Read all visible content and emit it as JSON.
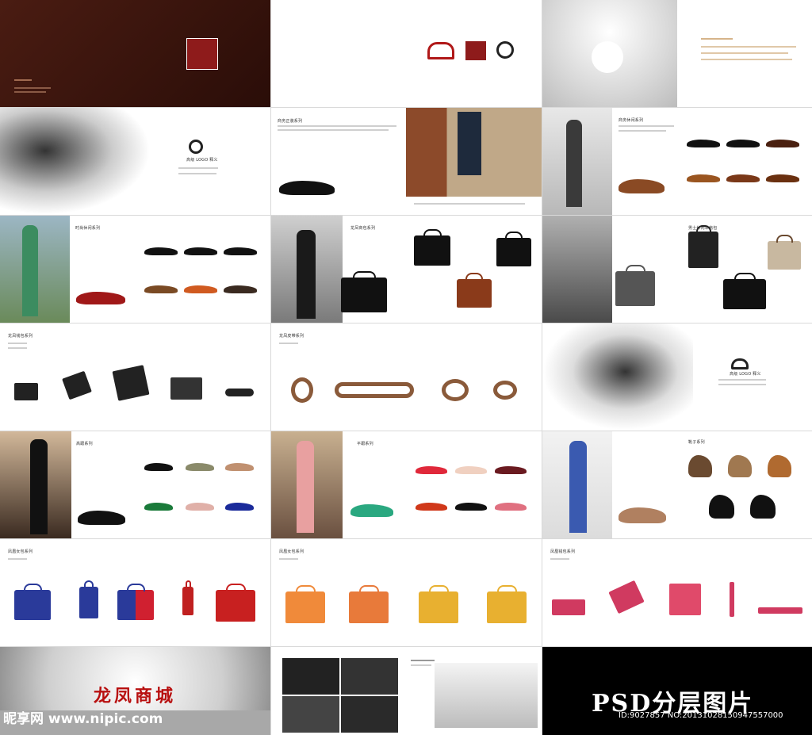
{
  "collage": {
    "bottom_title": "PSD分层图片",
    "watermark_site": "昵享网 www.nipic.com",
    "watermark_id": "ID:9027857 NO:20131028150947557000"
  },
  "pages": [
    {
      "name": "cover",
      "heading": ""
    },
    {
      "name": "brand-logos",
      "heading": ""
    },
    {
      "name": "store-interior",
      "heading": ""
    },
    {
      "name": "ink-dragon",
      "heading": "高级 LOGO 释义"
    },
    {
      "name": "business-formal-shoes",
      "heading": "商务正装系列"
    },
    {
      "name": "business-casual-shoes",
      "heading": "商务休闲系列"
    },
    {
      "name": "casual-shoes",
      "heading": "时尚休闲系列"
    },
    {
      "name": "business-bags",
      "heading": "龙凤商包系列"
    },
    {
      "name": "men-casual-bags",
      "heading": "男士休闲单肩包"
    },
    {
      "name": "wallets",
      "heading": "龙凤钱包系列"
    },
    {
      "name": "belts",
      "heading": "龙凤皮带系列"
    },
    {
      "name": "ink-phoenix",
      "heading": "高级 LOGO 释义"
    },
    {
      "name": "high-heels",
      "heading": "高跟系列"
    },
    {
      "name": "flats",
      "heading": "平跟系列"
    },
    {
      "name": "boots",
      "heading": "靴子系列"
    },
    {
      "name": "women-bags-1",
      "heading": "凤凰女包系列"
    },
    {
      "name": "women-bags-2",
      "heading": "凤凰女包系列"
    },
    {
      "name": "women-wallets",
      "heading": "凤凰钱包系列"
    },
    {
      "name": "store-front",
      "heading": "龙凤商城"
    },
    {
      "name": "store-photos",
      "heading": ""
    },
    {
      "name": "psd-banner",
      "heading": ""
    }
  ]
}
